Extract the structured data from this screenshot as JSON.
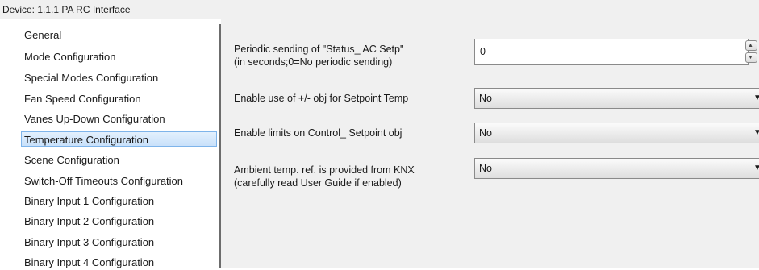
{
  "device_title": "Device: 1.1.1  PA RC Interface",
  "nav": [
    {
      "label": "General"
    },
    {
      "label": "Mode Configuration"
    },
    {
      "label": "Special Modes Configuration"
    },
    {
      "label": "Fan Speed Configuration"
    },
    {
      "label": "Vanes Up-Down Configuration"
    },
    {
      "label": "Temperature Configuration",
      "selected": true
    },
    {
      "label": "Scene Configuration"
    },
    {
      "label": "Switch-Off Timeouts Configuration"
    },
    {
      "label": "Binary Input 1 Configuration"
    },
    {
      "label": "Binary Input 2 Configuration"
    },
    {
      "label": "Binary Input 3 Configuration"
    },
    {
      "label": "Binary Input 4 Configuration"
    }
  ],
  "params": {
    "periodic": {
      "label_line1": "Periodic sending of \"Status_ AC Setp\"",
      "label_line2": "(in seconds;0=No periodic sending)",
      "value": "0"
    },
    "enable_pm": {
      "label": "Enable use of +/- obj for Setpoint Temp",
      "value": "No"
    },
    "enable_limits": {
      "label": "Enable limits on Control_ Setpoint obj",
      "value": "No"
    },
    "ambient": {
      "label_line1": "Ambient temp. ref. is provided from KNX",
      "label_line2": "(carefully read User Guide if enabled)",
      "value": "No"
    }
  },
  "icons": {
    "spin_up": "▲",
    "spin_down": "▼",
    "dropdown": "▼"
  }
}
